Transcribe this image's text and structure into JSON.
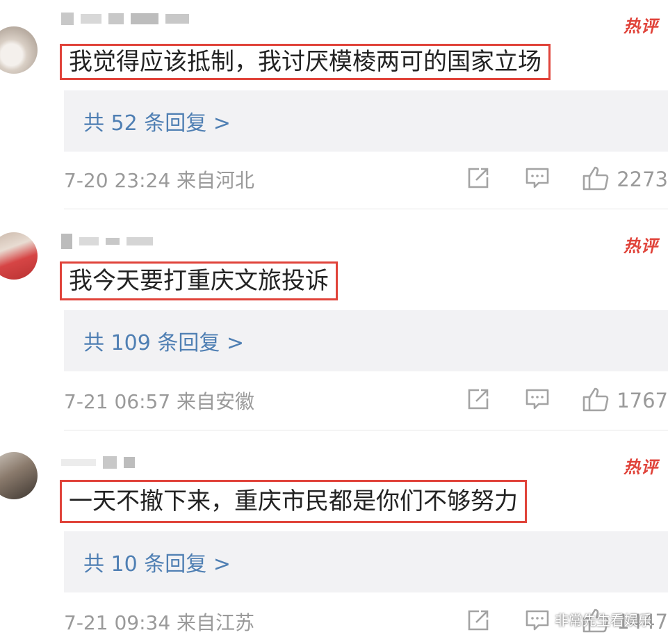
{
  "hot_label": "热评",
  "comments": [
    {
      "content": "我觉得应该抵制，我讨厌模棱两可的国家立场",
      "replies": "共 52 条回复 >",
      "time": "7-20 23:24 来自河北",
      "likes": "2273"
    },
    {
      "content": "我今天要打重庆文旅投诉",
      "replies": "共 109 条回复 >",
      "time": "7-21 06:57 来自安徽",
      "likes": "1767"
    },
    {
      "content": "一天不撤下来，重庆市民都是你们不够努力",
      "replies": "共 10 条回复 >",
      "time": "7-21 09:34 来自江苏",
      "likes": "1447"
    }
  ],
  "watermark": "非常先生看娱乐",
  "colors": {
    "accent": "#e0433a",
    "link": "#4f7fb3",
    "meta": "#9a9a9a",
    "reply_bg": "#f2f2f4"
  },
  "icons": [
    "share-icon",
    "comment-icon",
    "like-icon"
  ]
}
